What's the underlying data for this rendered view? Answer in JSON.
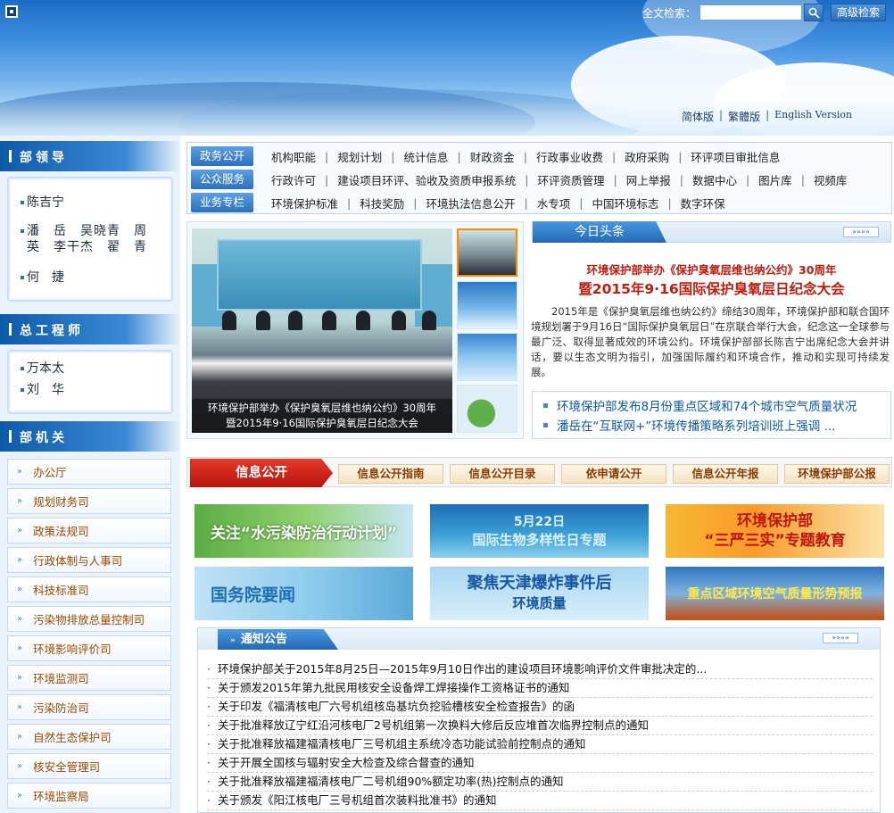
{
  "header": {
    "search_label": "全文检索：",
    "search_value": "",
    "advanced_search": "高级检索",
    "lang": {
      "simplified": "简体版",
      "traditional": "繁體版",
      "english": "English Version"
    }
  },
  "sidebar": {
    "leaders_title": "部领导",
    "leaders": [
      "陈吉宁",
      "潘　岳　吴晓青　周　英　李干杰　翟　青",
      "何　捷"
    ],
    "engineer_title": "总工程师",
    "engineers": [
      "万本太",
      "刘　华"
    ],
    "departments_title": "部机关",
    "departments": [
      "办公厅",
      "规划财务司",
      "政策法规司",
      "行政体制与人事司",
      "科技标准司",
      "污染物排放总量控制司",
      "环境影响评价司",
      "环境监测司",
      "污染防治司",
      "自然生态保护司",
      "核安全管理司",
      "环境监察局"
    ]
  },
  "nav": [
    {
      "tab": "政务公开",
      "items": [
        "机构职能",
        "规划计划",
        "统计信息",
        "财政资金",
        "行政事业收费",
        "政府采购",
        "环评项目审批信息"
      ]
    },
    {
      "tab": "公众服务",
      "items": [
        "行政许可",
        "建设项目环评、验收及资质申报系统",
        "环评资质管理",
        "网上举报",
        "数据中心",
        "图片库",
        "视频库"
      ]
    },
    {
      "tab": "业务专栏",
      "items": [
        "环境保护标准",
        "科技奖励",
        "环境执法信息公开",
        "水专项",
        "中国环境标志",
        "数字环保"
      ]
    }
  ],
  "slideshow": {
    "caption_line1": "环境保护部举办《保护臭氧层维也纳公约》30周年",
    "caption_line2": "暨2015年9·16国际保护臭氧层日纪念大会"
  },
  "headline": {
    "tab": "今日头条",
    "more": "»»»»",
    "title_line1": "环境保护部举办《保护臭氧层维也纳公约》30周年",
    "title_line2": "暨2015年9·16国际保护臭氧层日纪念大会",
    "summary": "2015年是《保护臭氧层维也纳公约》缔结30周年，环境保护部和联合国环境规划署于9月16日“国际保护臭氧层日”在京联合举行大会，纪念这一全球参与最广泛、取得显著成效的环境公约。环境保护部部长陈吉宁出席纪念大会并讲话，要以生态文明为指引，加强国际履约和环境合作，推动和实现可持续发展。",
    "links": [
      "环境保护部发布8月份重点区域和74个城市空气质量状况",
      "潘岳在“互联网+”环境传播策略系列培训班上强调 ..."
    ]
  },
  "info": {
    "main": "信息公开",
    "buttons": [
      "信息公开指南",
      "信息公开目录",
      "依申请公开",
      "信息公开年报",
      "环境保护部公报"
    ]
  },
  "banners": {
    "water": "关注“水污染防治行动计划”",
    "bio_date": "5月22日",
    "bio_title": "国际生物多样性日专题",
    "sanyan_org": "环境保护部",
    "sanyan_title": "“三严三实”专题教育",
    "state_council": "国务院要闻",
    "tianjin": "聚焦天津爆炸事件后",
    "tianjin_sub": "环境质量",
    "air": "重点区域环境空气质量形势预报"
  },
  "notices": {
    "tab": "通知公告",
    "more": "»»»»",
    "items": [
      "环境保护部关于2015年8月25日—2015年9月10日作出的建设项目环境影响评价文件审批决定的...",
      "关于颁发2015年第九批民用核安全设备焊工焊接操作工资格证书的通知",
      "关于印发《福清核电厂六号机组核岛基坑负挖验槽核安全检查报告》的函",
      "关于批准释放辽宁红沿河核电厂2号机组第一次换料大修后反应堆首次临界控制点的通知",
      "关于批准释放福建福清核电厂三号机组主系统冷态功能试验前控制点的通知",
      "关于开展全国核与辐射安全大检查及综合督查的通知",
      "关于批准释放福建福清核电厂二号机组90%额定功率(热)控制点的通知",
      "关于颁发《阳江核电厂三号机组首次装料批准书》的通知"
    ]
  },
  "colors": {
    "brand_blue": "#2369b6",
    "headline_red": "#c41a0c",
    "info_red": "#d12618",
    "dept_text": "#9a4a00"
  }
}
